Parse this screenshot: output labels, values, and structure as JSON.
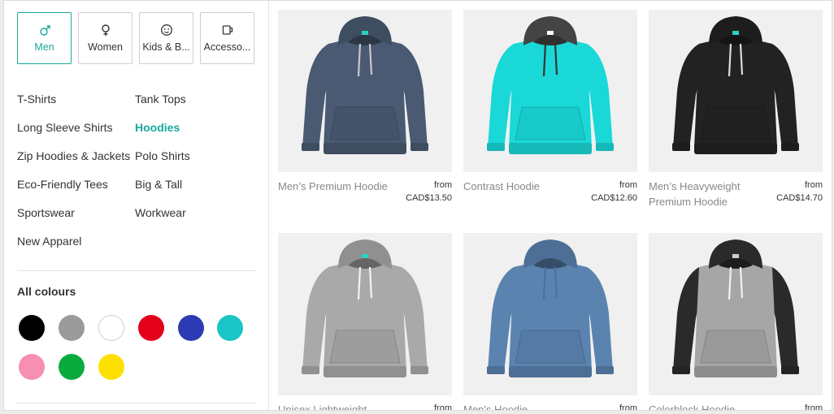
{
  "categories": [
    {
      "label": "Men",
      "icon": "male-icon",
      "active": true
    },
    {
      "label": "Women",
      "icon": "female-icon",
      "active": false
    },
    {
      "label": "Kids & B...",
      "icon": "baby-face-icon",
      "active": false
    },
    {
      "label": "Accesso...",
      "icon": "mug-icon",
      "active": false
    }
  ],
  "subcategories": [
    {
      "label": "T-Shirts",
      "active": false
    },
    {
      "label": "Tank Tops",
      "active": false
    },
    {
      "label": "Long Sleeve Shirts",
      "active": false
    },
    {
      "label": "Hoodies",
      "active": true
    },
    {
      "label": "Zip Hoodies & Jackets",
      "active": false
    },
    {
      "label": "Polo Shirts",
      "active": false
    },
    {
      "label": "Eco-Friendly Tees",
      "active": false
    },
    {
      "label": "Big & Tall",
      "active": false
    },
    {
      "label": "Sportswear",
      "active": false
    },
    {
      "label": "Workwear",
      "active": false
    },
    {
      "label": "New Apparel",
      "active": false
    }
  ],
  "colours": {
    "title": "All colours",
    "swatches": [
      "#000000",
      "#9b9b9b",
      "#ffffff",
      "#e2001a",
      "#2b3bb3",
      "#19c5c5",
      "#f78fb0",
      "#0aab3e",
      "#fde000"
    ]
  },
  "accent_color": "#1aa99a",
  "products": [
    {
      "name": "Men’s Premium Hoodie",
      "from": "from",
      "price": "CAD$13.50",
      "body": "#4a5a72",
      "strings": "#c9c9c9",
      "tag": "#2ad1c1"
    },
    {
      "name": "Contrast Hoodie",
      "from": "from",
      "price": "CAD$12.60",
      "body": "#1ad8d8",
      "strings": "#333333",
      "tag": "#ffffff",
      "hood": "#444444"
    },
    {
      "name": "Men’s Heavyweight Premium Hoodie",
      "from": "from",
      "price": "CAD$14.70",
      "body": "#222222",
      "strings": "#dcdcdc",
      "tag": "#2ad1c1"
    },
    {
      "name": "Unisex Lightweight",
      "from": "from",
      "price": "",
      "body": "#a9a9a9",
      "strings": "#f2f2f2",
      "tag": "#2ad1c1"
    },
    {
      "name": "Men’s Hoodie",
      "from": "from",
      "price": "",
      "body": "#5b83b0",
      "strings": "#4c71a0",
      "tag": "#4c71a0"
    },
    {
      "name": "Colorblock Hoodie",
      "from": "from",
      "price": "",
      "body": "#a6a6a6",
      "strings": "#f2f2f2",
      "tag": "#cfcfcf",
      "sleeves": "#2a2a2a",
      "hood": "#2a2a2a"
    }
  ]
}
